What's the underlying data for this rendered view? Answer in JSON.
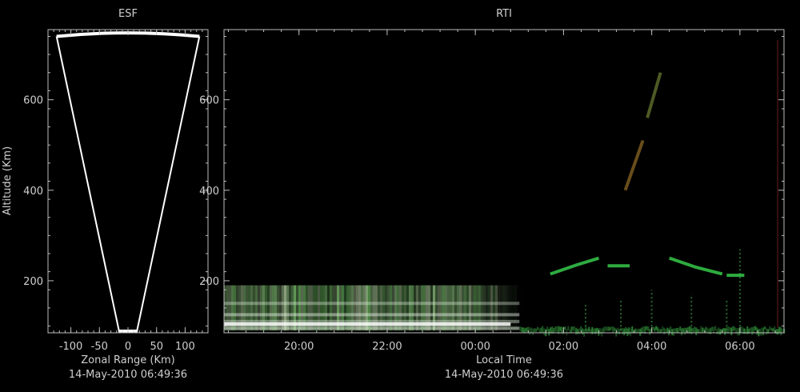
{
  "colors": {
    "background": "#000000",
    "axis": "#bdbdbd",
    "text": "#cfcfcf",
    "fan": "#ffffff",
    "echo_green": "#3fcf5a",
    "echo_white": "#e8f3e6",
    "echo_red": "#c0392b"
  },
  "chart_data": [
    {
      "type": "scatter",
      "title": "ESF",
      "xlabel": "Zonal Range (Km)",
      "ylabel": "Altitude (Km)",
      "footer": "14-May-2010 06:49:36",
      "xlim": [
        -140,
        140
      ],
      "ylim": [
        85,
        755
      ],
      "xticks": [
        -100,
        -50,
        0,
        50,
        100
      ],
      "xtick_labels": [
        "-100",
        "-50",
        "0",
        "50",
        "100"
      ],
      "yticks": [
        200,
        400,
        600
      ],
      "ytick_labels": [
        "200",
        "400",
        "600"
      ],
      "beam": {
        "apex_x": 0,
        "apex_y": 85,
        "left_bottom_x": -15,
        "right_bottom_x": 15,
        "left_top_x": -125,
        "right_top_x": 125,
        "top_y": 740,
        "top_peak_y": 745
      }
    },
    {
      "type": "heatmap",
      "title": "RTI",
      "xlabel": "Local Time",
      "ylabel": "",
      "footer": "14-May-2010 06:49:36",
      "xlim": [
        18.3,
        31.0
      ],
      "ylim": [
        85,
        755
      ],
      "xticks": [
        20,
        22,
        24,
        26,
        28,
        30
      ],
      "xtick_labels": [
        "20:00",
        "22:00",
        "00:00",
        "02:00",
        "04:00",
        "06:00"
      ],
      "yticks": [
        200,
        400,
        600
      ],
      "ytick_labels": [
        "200",
        "400",
        "600"
      ],
      "layers": [
        {
          "name": "",
          "t_start": 18.3,
          "t_end": 25.0,
          "alt_low": 90,
          "alt_high": 190,
          "color": "#cfe8cb"
        },
        {
          "name": "",
          "t_start": 18.3,
          "t_end": 24.8,
          "alt_low": 100,
          "alt_high": 108,
          "color": "#ffffff"
        },
        {
          "name": "",
          "t_start": 25.0,
          "t_end": 31.0,
          "alt_low": 90,
          "alt_high": 100,
          "color": "#2e8a36"
        }
      ],
      "echo_traces": [
        {
          "t": [
            25.7,
            26.3,
            26.8
          ],
          "alt": [
            215,
            235,
            250
          ],
          "color": "#36c94a"
        },
        {
          "t": [
            27.0,
            27.5
          ],
          "alt": [
            233,
            233
          ],
          "color": "#36c94a"
        },
        {
          "t": [
            28.4,
            29.0,
            29.6
          ],
          "alt": [
            250,
            230,
            215
          ],
          "color": "#36c94a"
        },
        {
          "t": [
            29.7,
            30.1
          ],
          "alt": [
            212,
            212
          ],
          "color": "#36c94a"
        },
        {
          "t": [
            27.4,
            27.8
          ],
          "alt": [
            400,
            510
          ],
          "color": "#7a5a1f"
        },
        {
          "t": [
            27.9,
            28.2
          ],
          "alt": [
            560,
            660
          ],
          "color": "#5a6a2a"
        }
      ],
      "plumes": [
        {
          "t": 26.5,
          "alt_low": 90,
          "alt_high": 150,
          "color": "#2f7f3a"
        },
        {
          "t": 27.3,
          "alt_low": 90,
          "alt_high": 160,
          "color": "#2f7f3a"
        },
        {
          "t": 28.0,
          "alt_low": 90,
          "alt_high": 180,
          "color": "#2f7f3a"
        },
        {
          "t": 28.9,
          "alt_low": 90,
          "alt_high": 170,
          "color": "#2f7f3a"
        },
        {
          "t": 29.7,
          "alt_low": 90,
          "alt_high": 160,
          "color": "#2f7f3a"
        },
        {
          "t": 30.0,
          "alt_low": 90,
          "alt_high": 270,
          "color": "#2f7f3a"
        }
      ]
    }
  ]
}
